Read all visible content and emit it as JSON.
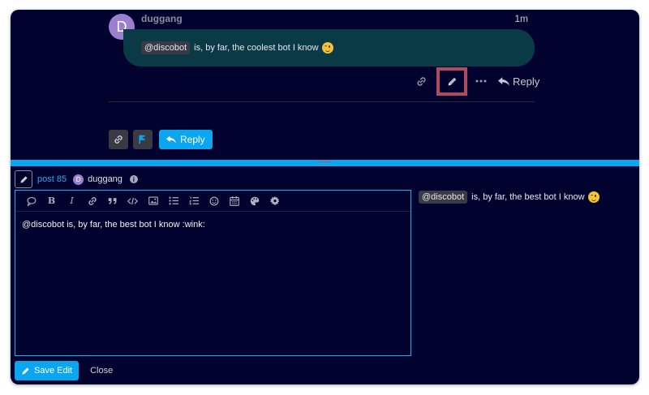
{
  "post": {
    "avatar_letter": "D",
    "username": "duggang",
    "time": "1m",
    "mention": "@discobot",
    "text": "is, by far, the coolest bot I know",
    "emoji": "wink-emoji"
  },
  "post_actions": {
    "link_icon": "link-icon",
    "edit_icon": "pencil-icon",
    "more_icon": "ellipsis-icon",
    "reply_label": "Reply"
  },
  "topic_buttons": {
    "reply_label": "Reply"
  },
  "composer": {
    "post_ref": "post 85",
    "avatar_letter": "D",
    "username": "duggang",
    "info_glyph": "i",
    "editor_text": "@discobot is, by far, the best bot I know :wink:",
    "preview_mention": "@discobot",
    "preview_text": "is, by far, the best bot I know",
    "save_label": "Save Edit",
    "close_label": "Close"
  },
  "colors": {
    "background": "#02022e",
    "accent": "#0aa6f0",
    "bubble": "#0a3a46",
    "highlight": "#b04a5e"
  }
}
